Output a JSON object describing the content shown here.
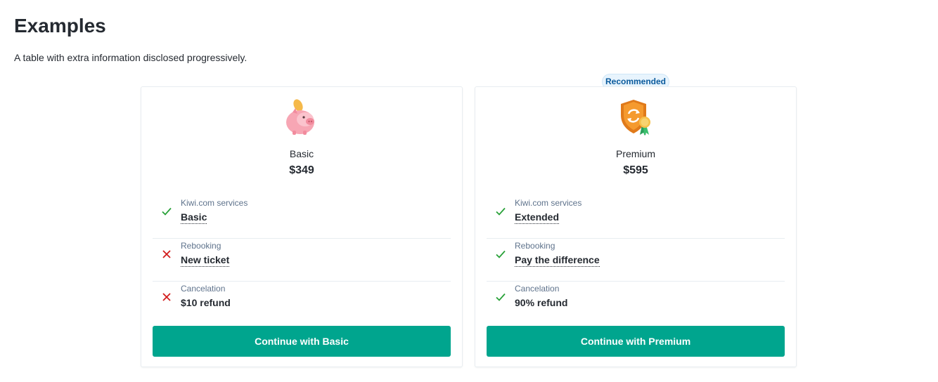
{
  "header": {
    "title": "Examples",
    "description": "A table with extra information disclosed progressively."
  },
  "colors": {
    "accent": "#00a58e",
    "check": "#28a138",
    "cross": "#d21c1c",
    "badge_bg": "#e8f4fd",
    "badge_text": "#0a5a9c"
  },
  "cards": [
    {
      "name": "Basic",
      "price": "$349",
      "illustration": "piggy-bank-icon",
      "features": [
        {
          "label": "Kiwi.com services",
          "value": "Basic",
          "included": true
        },
        {
          "label": "Rebooking",
          "value": "New ticket",
          "included": false
        },
        {
          "label": "Cancelation",
          "value": "$10 refund",
          "included": false
        }
      ],
      "cta": "Continue with Basic"
    },
    {
      "name": "Premium",
      "badge": "Recommended",
      "price": "$595",
      "illustration": "premium-shield-badge-icon",
      "features": [
        {
          "label": "Kiwi.com services",
          "value": "Extended",
          "included": true
        },
        {
          "label": "Rebooking",
          "value": "Pay the difference",
          "included": true
        },
        {
          "label": "Cancelation",
          "value": "90% refund",
          "included": true
        }
      ],
      "cta": "Continue with Premium"
    }
  ]
}
